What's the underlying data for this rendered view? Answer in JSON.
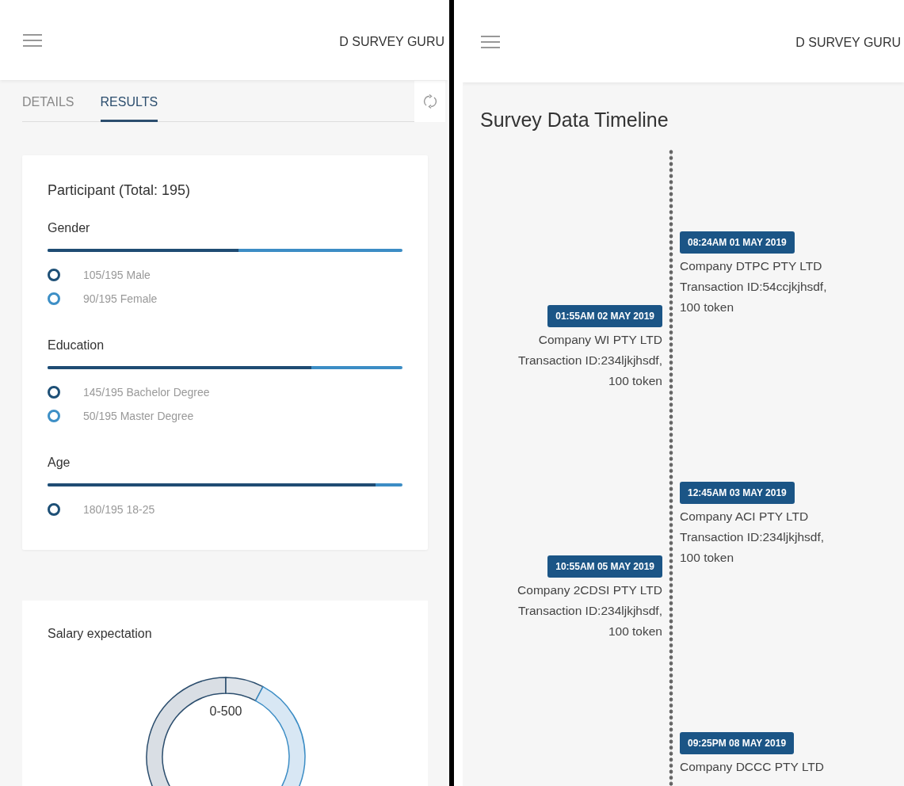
{
  "left_screen": {
    "header": {
      "title": "D SURVEY GURU"
    },
    "tabs": [
      {
        "label": "DETAILS",
        "selected": false
      },
      {
        "label": "RESULTS",
        "selected": true
      }
    ],
    "participant_card": {
      "title": "Participant (Total: 195)",
      "groups": [
        {
          "label": "Gender",
          "level": 0.538,
          "legend": [
            {
              "text": "105/195 Male",
              "color": "#1d4f76"
            },
            {
              "text": "90/195 Female",
              "color": "#3d8fc6"
            }
          ]
        },
        {
          "label": "Education",
          "level": 0.744,
          "legend": [
            {
              "text": "145/195 Bachelor Degree",
              "color": "#1d4f76"
            },
            {
              "text": "50/195 Master Degree",
              "color": "#3d8fc6"
            }
          ]
        },
        {
          "label": "Age",
          "level": 0.923,
          "legend": [
            {
              "text": "180/195 18-25",
              "color": "#1d4f76"
            }
          ]
        }
      ]
    },
    "salary_card": {
      "title": "Salary expectation",
      "center_label": "0-500"
    }
  },
  "right_screen": {
    "header": {
      "title": "D SURVEY GURU"
    },
    "title": "Survey Data Timeline",
    "timeline": [
      {
        "kind": "right",
        "time": "08:24AM 01 MAY 2019",
        "company": "Company DTPC PTY LTD",
        "transaction": "Transaction ID:54ccjkjhsdf,",
        "tokens": "100 token"
      },
      {
        "kind": "left",
        "time": "01:55AM 02 MAY 2019",
        "company": "Company WI PTY LTD",
        "transaction": "Transaction ID:234ljkjhsdf,",
        "tokens": "100 token"
      },
      {
        "kind": "right",
        "time": "12:45AM 03 MAY 2019",
        "company": "Company ACI PTY LTD",
        "transaction": "Transaction ID:234ljkjhsdf,",
        "tokens": "100 token"
      },
      {
        "kind": "left",
        "time": "10:55AM 05 MAY 2019",
        "company": "Company 2CDSI PTY LTD",
        "transaction": "Transaction ID:234ljkjhsdf,",
        "tokens": "100 token"
      },
      {
        "kind": "right",
        "time": "09:25PM 08 MAY 2019",
        "company": "Company DCCC PTY LTD"
      }
    ]
  }
}
